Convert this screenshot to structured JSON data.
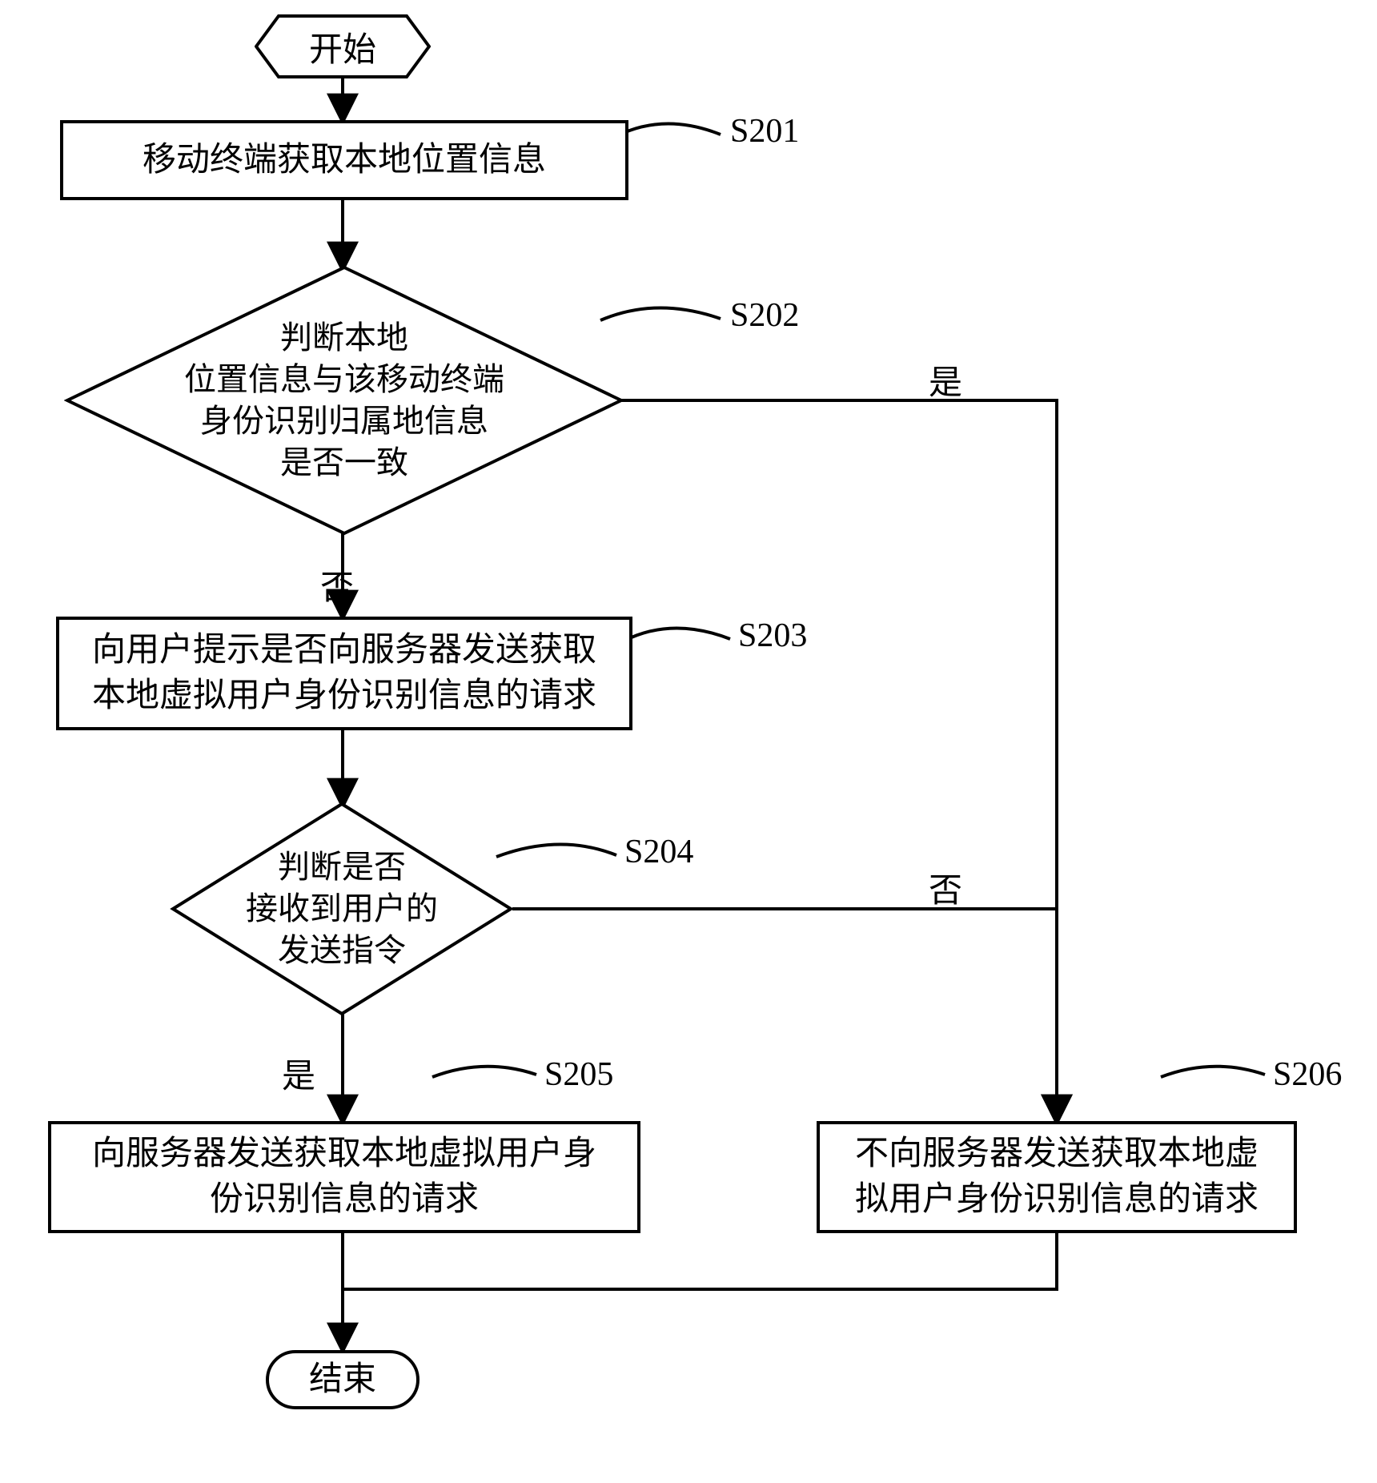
{
  "chart_data": {
    "type": "flowchart",
    "nodes": [
      {
        "id": "start",
        "shape": "hexagon",
        "text": "开始"
      },
      {
        "id": "S201",
        "shape": "rect",
        "text": "移动终端获取本地位置信息",
        "tag": "S201"
      },
      {
        "id": "S202",
        "shape": "diamond",
        "text": "判断本地\n位置信息与该移动终端\n身份识别归属地信息\n是否一致",
        "tag": "S202"
      },
      {
        "id": "S203",
        "shape": "rect",
        "text": "向用户提示是否向服务器发送获取\n本地虚拟用户身份识别信息的请求",
        "tag": "S203"
      },
      {
        "id": "S204",
        "shape": "diamond",
        "text": "判断是否\n接收到用户的\n发送指令",
        "tag": "S204"
      },
      {
        "id": "S205",
        "shape": "rect",
        "text": "向服务器发送获取本地虚拟用户身\n份识别信息的请求",
        "tag": "S205"
      },
      {
        "id": "S206",
        "shape": "rect",
        "text": "不向服务器发送获取本地虚\n拟用户身份识别信息的请求",
        "tag": "S206"
      },
      {
        "id": "end",
        "shape": "terminator",
        "text": "结束"
      }
    ],
    "edges": [
      {
        "from": "start",
        "to": "S201"
      },
      {
        "from": "S201",
        "to": "S202"
      },
      {
        "from": "S202",
        "to": "S203",
        "label": "否"
      },
      {
        "from": "S202",
        "to": "S206",
        "label": "是"
      },
      {
        "from": "S203",
        "to": "S204"
      },
      {
        "from": "S204",
        "to": "S205",
        "label": "是"
      },
      {
        "from": "S204",
        "to": "S206",
        "label": "否"
      },
      {
        "from": "S205",
        "to": "end"
      },
      {
        "from": "S206",
        "to": "end"
      }
    ]
  },
  "start": {
    "label": "开始"
  },
  "s201": {
    "text": "移动终端获取本地位置信息",
    "tag": "S201"
  },
  "s202": {
    "text": "判断本地\n位置信息与该移动终端\n身份识别归属地信息\n是否一致",
    "tag": "S202"
  },
  "s203": {
    "line1": "向用户提示是否向服务器发送获取",
    "line2": "本地虚拟用户身份识别信息的请求",
    "tag": "S203"
  },
  "s204": {
    "text": "判断是否\n接收到用户的\n发送指令",
    "tag": "S204"
  },
  "s205": {
    "line1": "向服务器发送获取本地虚拟用户身",
    "line2": "份识别信息的请求",
    "tag": "S205"
  },
  "s206": {
    "line1": "不向服务器发送获取本地虚",
    "line2": "拟用户身份识别信息的请求",
    "tag": "S206"
  },
  "end": {
    "label": "结束"
  },
  "edge_labels": {
    "yes": "是",
    "no": "否"
  }
}
